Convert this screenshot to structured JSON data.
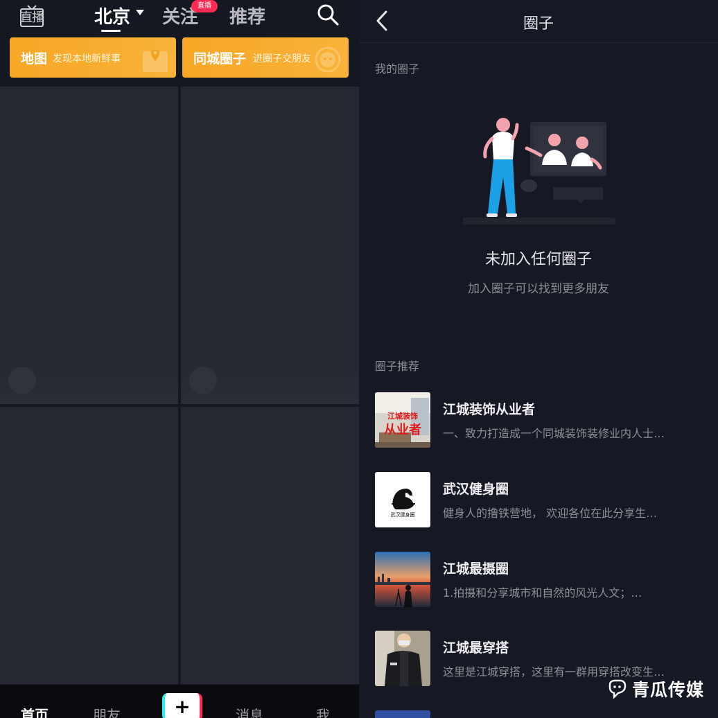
{
  "left": {
    "topnav": {
      "live_label": "直播",
      "city": "北京",
      "follow": "关注",
      "live_badge": "直播",
      "recommend": "推荐"
    },
    "promos": [
      {
        "title": "地图",
        "subtitle": "发现本地新鲜事"
      },
      {
        "title": "同城圈子",
        "subtitle": "进圈子交朋友"
      }
    ],
    "bottom_nav": {
      "home": "首页",
      "friends": "朋友",
      "messages": "消息",
      "me": "我",
      "plus": "+"
    }
  },
  "right": {
    "title": "圈子",
    "my_circles_label": "我的圈子",
    "empty_title": "未加入任何圈子",
    "empty_subtitle": "加入圈子可以找到更多朋友",
    "recommend_label": "圈子推荐",
    "circles": [
      {
        "name": "江城装饰从业者",
        "desc": "一、致力打造成一个同城装饰装修业内人士…",
        "thumb_text": "江城装饰从业者"
      },
      {
        "name": "武汉健身圈",
        "desc": "健身人的撸铁营地， 欢迎各位在此分享生…",
        "thumb_text": "武汉健身圈"
      },
      {
        "name": "江城最摄圈",
        "desc": "1.拍摄和分享城市和自然的风光人文；…"
      },
      {
        "name": "江城最穿搭",
        "desc": "这里是江城穿搭，这里有一群用穿搭改变生…"
      }
    ]
  },
  "watermark": "青瓜传媒",
  "colors": {
    "accent_red": "#fe2c55",
    "accent_cyan": "#25f4ee",
    "promo_orange": "#f7a725",
    "bg_dark": "#161823"
  }
}
